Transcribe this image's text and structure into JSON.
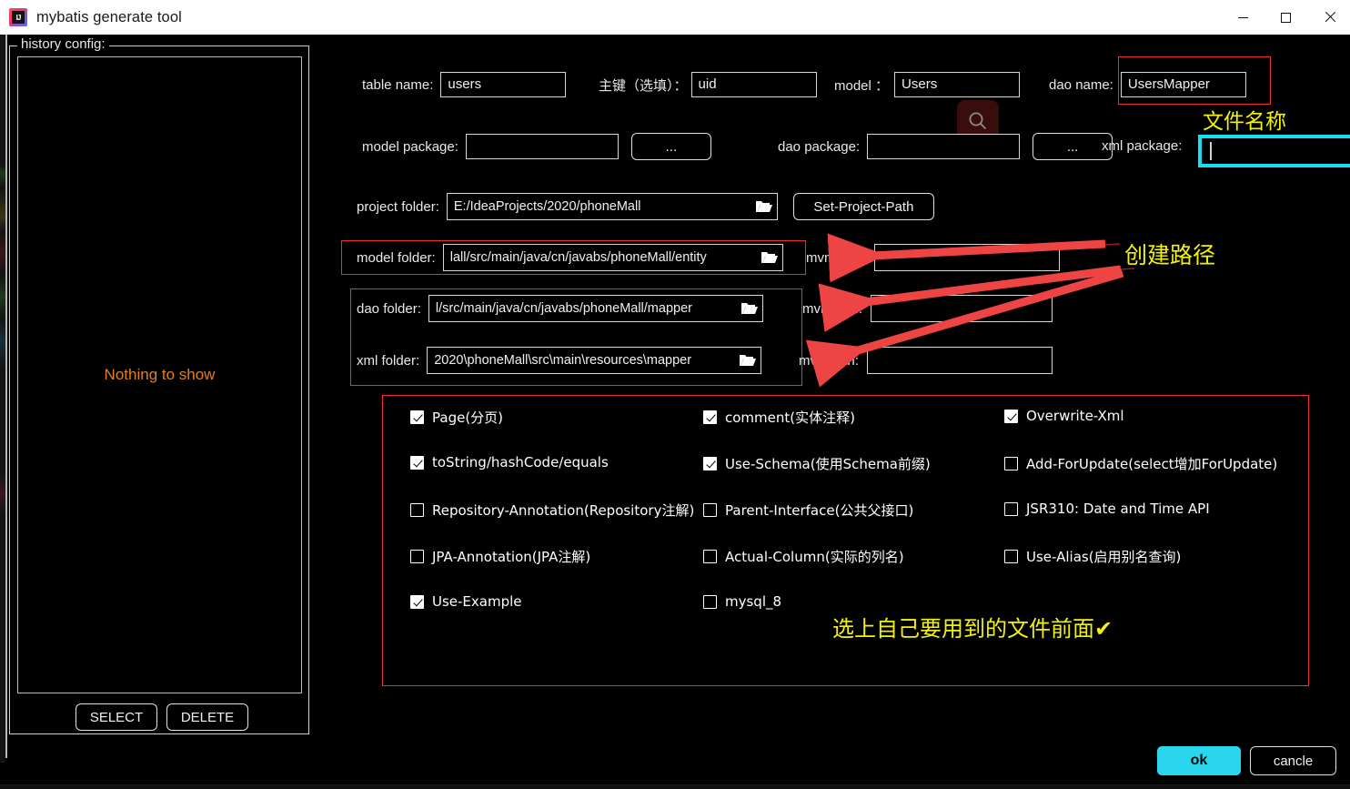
{
  "window": {
    "title": "mybatis generate tool",
    "icon": "intellij-idea-icon",
    "controls": {
      "minimize": "minimize-icon",
      "maximize": "maximize-icon",
      "close": "close-icon"
    }
  },
  "history": {
    "legend": "history config:",
    "empty_text": "Nothing to show",
    "select_label": "SELECT",
    "delete_label": "DELETE"
  },
  "form": {
    "table_name_label": "table  name:",
    "table_name_value": "users",
    "primary_key_label": "主键（选填）：",
    "primary_key_value": "uid",
    "model_label": "model  ：",
    "model_value": "Users",
    "dao_name_label": "dao name:",
    "dao_name_value": "UsersMapper",
    "model_package_label": "model package:",
    "model_package_value": "",
    "model_package_browse": "...",
    "dao_package_label": "dao package:",
    "dao_package_value": "",
    "dao_package_browse": "...",
    "xml_package_label": "xml package:",
    "xml_package_value": "",
    "project_folder_label": "project folder:",
    "project_folder_value": "E:/IdeaProjects/2020/phoneMall",
    "set_project_path_label": "Set-Project-Path",
    "model_folder_label": "model  folder:",
    "model_folder_value": "lall/src/main/java/cn/javabs/phoneMall/entity",
    "model_mvn_label": "mvn path:",
    "model_mvn_value": "",
    "dao_folder_label": "dao     folder:",
    "dao_folder_value": "l/src/main/java/cn/javabs/phoneMall/mapper",
    "dao_mvn_label": "mvn path:",
    "dao_mvn_value": "",
    "xml_folder_label": "xml     folder:",
    "xml_folder_value": "2020\\phoneMall\\src\\main\\resources\\mapper",
    "xml_mvn_label": "mvn path:",
    "xml_mvn_value": "",
    "search_icon": "search-icon"
  },
  "options": [
    {
      "label": "Page(分页)",
      "checked": true,
      "col": 0,
      "row": 0
    },
    {
      "label": "comment(实体注释)",
      "checked": true,
      "col": 1,
      "row": 0
    },
    {
      "label": "Overwrite-Xml",
      "checked": true,
      "col": 2,
      "row": 0
    },
    {
      "label": "toString/hashCode/equals",
      "checked": true,
      "col": 0,
      "row": 1
    },
    {
      "label": "Use-Schema(使用Schema前缀)",
      "checked": true,
      "col": 1,
      "row": 1
    },
    {
      "label": "Add-ForUpdate(select增加ForUpdate)",
      "checked": false,
      "col": 2,
      "row": 1
    },
    {
      "label": "Repository-Annotation(Repository注解)",
      "checked": false,
      "col": 0,
      "row": 2
    },
    {
      "label": "Parent-Interface(公共父接口)",
      "checked": false,
      "col": 1,
      "row": 2
    },
    {
      "label": "JSR310: Date and Time API",
      "checked": false,
      "col": 2,
      "row": 2
    },
    {
      "label": "JPA-Annotation(JPA注解)",
      "checked": false,
      "col": 0,
      "row": 3
    },
    {
      "label": "Actual-Column(实际的列名)",
      "checked": false,
      "col": 1,
      "row": 3
    },
    {
      "label": "Use-Alias(启用别名查询)",
      "checked": false,
      "col": 2,
      "row": 3
    },
    {
      "label": "Use-Example",
      "checked": true,
      "col": 0,
      "row": 4
    },
    {
      "label": "mysql_8",
      "checked": false,
      "col": 1,
      "row": 4
    }
  ],
  "annotations": {
    "file_name_note": "文件名称",
    "create_path_note": "创建路径",
    "checkbox_note": "选上自己要用到的文件前面✔",
    "highlight_color": "#ef3030",
    "note_color": "#f2f20a",
    "focus_color": "#18dcf2"
  },
  "footer": {
    "ok_label": "ok",
    "cancel_label": "cancle"
  }
}
